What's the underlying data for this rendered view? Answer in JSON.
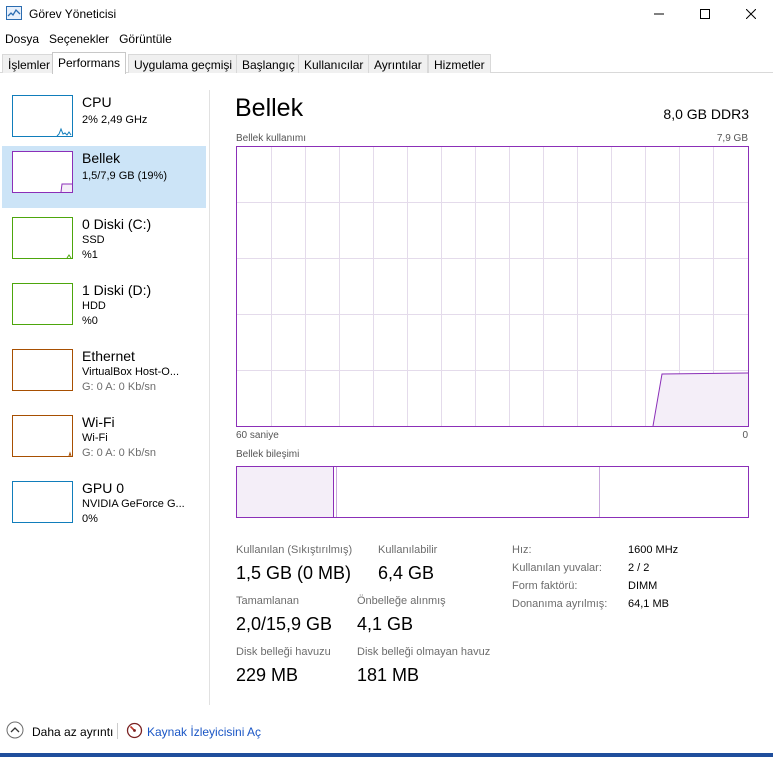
{
  "window": {
    "title": "Görev Yöneticisi"
  },
  "menu": [
    "Dosya",
    "Seçenekler",
    "Görüntüle"
  ],
  "tabs": [
    "İşlemler",
    "Performans",
    "Uygulama geçmişi",
    "Başlangıç",
    "Kullanıcılar",
    "Ayrıntılar",
    "Hizmetler"
  ],
  "active_tab": "Performans",
  "sidebar": {
    "items": [
      {
        "title": "CPU",
        "line1": "2% 2,49 GHz",
        "line2": "",
        "color": "#117dbb"
      },
      {
        "title": "Bellek",
        "line1": "1,5/7,9 GB (19%)",
        "line2": "",
        "color": "#8b2fb8",
        "selected": true
      },
      {
        "title": "0 Diski (C:)",
        "line1": "SSD",
        "line2": "%1",
        "color": "#4da60c"
      },
      {
        "title": "1 Diski (D:)",
        "line1": "HDD",
        "line2": "%0",
        "color": "#4da60c"
      },
      {
        "title": "Ethernet",
        "line1": "VirtualBox Host-O...",
        "line2": "G: 0 A: 0 Kb/sn",
        "color": "#a74f01"
      },
      {
        "title": "Wi-Fi",
        "line1": "Wi-Fi",
        "line2": "G: 0 A: 0 Kb/sn",
        "color": "#a74f01"
      },
      {
        "title": "GPU 0",
        "line1": "NVIDIA GeForce G...",
        "line2": "0%",
        "color": "#117dbb"
      }
    ]
  },
  "main": {
    "title": "Bellek",
    "spec": "8,0 GB DDR3",
    "usage_label": "Bellek kullanımı",
    "usage_max": "7,9 GB",
    "time_left": "60 saniye",
    "time_right": "0",
    "composition_label": "Bellek bileşimi",
    "graph_color": "#8b2fb8",
    "memory_in_use_fraction": 0.19,
    "stats": {
      "in_use_label": "Kullanılan (Sıkıştırılmış)",
      "in_use_value": "1,5 GB (0 MB)",
      "available_label": "Kullanılabilir",
      "available_value": "6,4 GB",
      "committed_label": "Tamamlanan",
      "committed_value": "2,0/15,9 GB",
      "cached_label": "Önbelleğe alınmış",
      "cached_value": "4,1 GB",
      "paged_label": "Disk belleği havuzu",
      "paged_value": "229 MB",
      "nonpaged_label": "Disk belleği olmayan havuz",
      "nonpaged_value": "181 MB"
    },
    "info": {
      "speed_label": "Hız:",
      "speed_value": "1600 MHz",
      "slots_label": "Kullanılan yuvalar:",
      "slots_value": "2 / 2",
      "form_label": "Form faktörü:",
      "form_value": "DIMM",
      "reserved_label": "Donanıma ayrılmış:",
      "reserved_value": "64,1 MB"
    }
  },
  "footer": {
    "fewer_details": "Daha az ayrıntı",
    "resource_monitor": "Kaynak İzleyicisini Aç"
  }
}
